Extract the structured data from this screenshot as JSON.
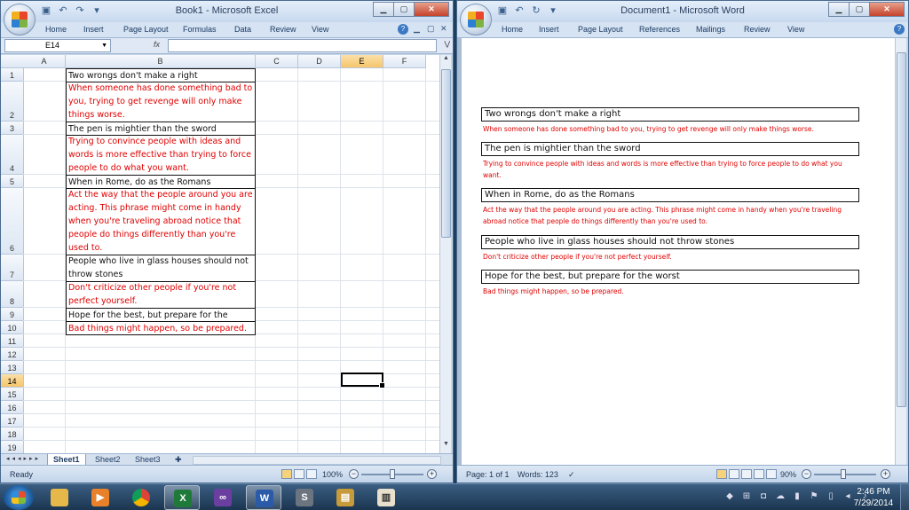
{
  "excel": {
    "title": "Book1 - Microsoft Excel",
    "tabs": [
      "Home",
      "Insert",
      "Page Layout",
      "Formulas",
      "Data",
      "Review",
      "View"
    ],
    "namebox": "E14",
    "fx": "fx",
    "columns": [
      "A",
      "B",
      "C",
      "D",
      "E",
      "F"
    ],
    "rows": [
      "1",
      "2",
      "3",
      "4",
      "5",
      "6",
      "7",
      "8",
      "9",
      "10",
      "11",
      "12",
      "13",
      "14",
      "15",
      "16",
      "17",
      "18",
      "19"
    ],
    "cells": [
      {
        "row": "1",
        "text": "Two wrongs don't make a right",
        "color": "#111111"
      },
      {
        "row": "2",
        "text": "When someone has done something bad to you, trying to get revenge will only make things worse.",
        "color": "#e00000"
      },
      {
        "row": "3",
        "text": "The pen is mightier than the sword",
        "color": "#111111"
      },
      {
        "row": "4",
        "text": "Trying to convince people with ideas and words is more effective than trying to force people to do what you want.",
        "color": "#e00000"
      },
      {
        "row": "5",
        "text": "When in Rome, do as the Romans",
        "color": "#111111"
      },
      {
        "row": "6",
        "text": "Act the way that the people around you are acting. This phrase might come in handy when you're traveling abroad notice that people do things differently than you're used to.",
        "color": "#e00000"
      },
      {
        "row": "7",
        "text": "People who live in glass houses should not throw stones",
        "color": "#111111"
      },
      {
        "row": "8",
        "text": "Don't criticize other people if you're not perfect yourself.",
        "color": "#e00000"
      },
      {
        "row": "9",
        "text": "Hope for the best, but prepare for the worst",
        "color": "#111111"
      },
      {
        "row": "10",
        "text": "Bad things might happen, so be prepared.",
        "color": "#e00000"
      }
    ],
    "sheets": [
      "Sheet1",
      "Sheet2",
      "Sheet3"
    ],
    "status": "Ready",
    "zoom": "100%"
  },
  "word": {
    "title": "Document1 - Microsoft Word",
    "tabs": [
      "Home",
      "Insert",
      "Page Layout",
      "References",
      "Mailings",
      "Review",
      "View"
    ],
    "items": [
      {
        "heading": "Two wrongs don't make a right",
        "desc": "When someone has done something bad to you, trying to get revenge will only make things worse."
      },
      {
        "heading": "The pen is mightier than the sword",
        "desc": "Trying to convince people with ideas and words is more effective than trying to force people to do what you want."
      },
      {
        "heading": "When in Rome, do as the Romans",
        "desc": "Act the way that the people around you are acting. This phrase might come in handy when you're traveling abroad notice that people do things differently than you're used to."
      },
      {
        "heading": "People who live in glass houses should not throw stones",
        "desc": "Don't criticize other people if you're not perfect yourself."
      },
      {
        "heading": "Hope for the best, but prepare for the worst",
        "desc": "Bad things might happen, so be prepared."
      }
    ],
    "page_status": "Page: 1 of 1",
    "words_status": "Words: 123",
    "zoom": "90%"
  },
  "taskbar": {
    "apps": [
      "windows-explorer",
      "media-player",
      "chrome",
      "excel",
      "visual-studio",
      "word",
      "snagit",
      "dictionary",
      "book-reader"
    ],
    "time": "2:46 PM",
    "date": "7/29/2014"
  }
}
